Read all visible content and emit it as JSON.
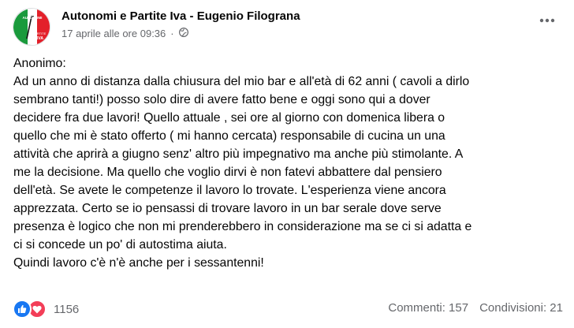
{
  "post": {
    "author": "Autonomi e Partite Iva - Eugenio Filograna",
    "timestamp": "17 aprile alle ore 09:36",
    "separator": "·",
    "visibility_icon": "globe-icon",
    "more_icon": "more-horizontal-icon",
    "avatar": {
      "logo_top": "AUTONOMI",
      "logo_bottom": "PARTITE",
      "logo_iva": "IVA",
      "colors": {
        "green": "#1a9a3c",
        "red": "#e3202a"
      }
    },
    "body": "Anonimo:\nAd un anno di distanza dalla chiusura del mio bar e all'età di 62 anni ( cavoli a dirlo\nsembrano tanti!) posso solo dire di avere fatto bene e oggi sono qui a dover\ndecidere fra due lavori! Quello attuale , sei ore al giorno con domenica libera o\nquello che mi è stato offerto ( mi hanno cercata) responsabile di cucina un una\nattività che aprirà a giugno senz' altro più impegnativo ma anche più stimolante. A\nme la decisione. Ma quello che voglio dirvi è non fatevi abbattere dal pensiero\ndell'età. Se avete le competenze il lavoro lo trovate. L'esperienza viene ancora\napprezzata. Certo se io pensassi di trovare lavoro in un bar serale dove serve\npresenza è logico che non mi prenderebbero in considerazione ma se  ci si adatta e\nci si concede un po' di autostima aiuta.\nQuindi lavoro c'è n'è anche per i sessantenni!"
  },
  "footer": {
    "reaction_icons": [
      "like-icon",
      "love-icon"
    ],
    "reactions_count": "1156",
    "comments": "Commenti: 157",
    "shares": "Condivisioni: 21"
  },
  "colors": {
    "text": "#050505",
    "secondary": "#65676b",
    "like": "#1877f2",
    "love": "#f33e58"
  }
}
